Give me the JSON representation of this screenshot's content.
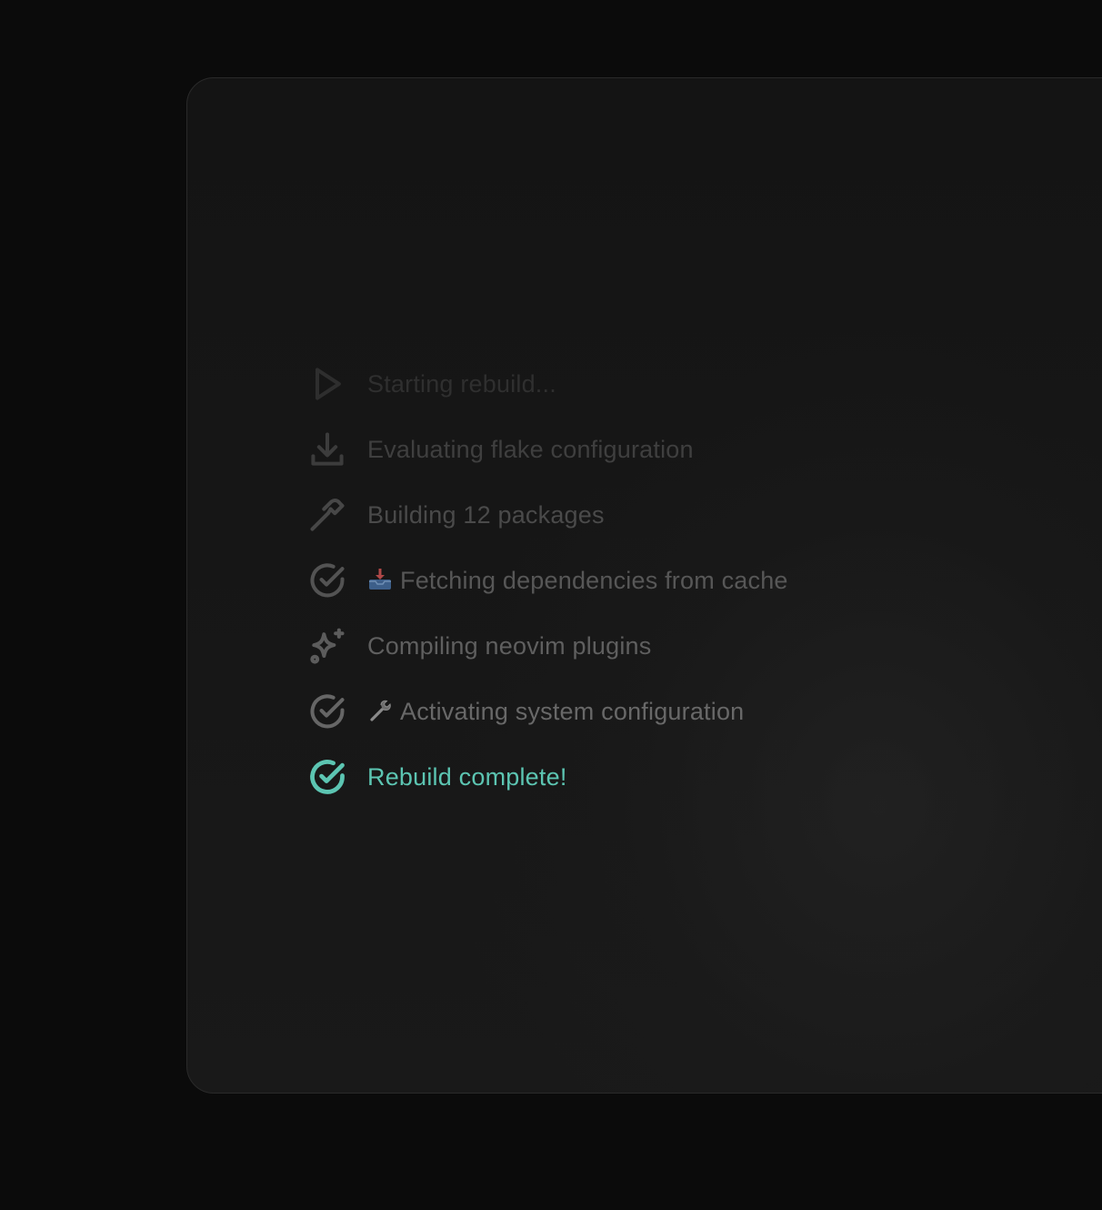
{
  "steps": [
    {
      "icon": "play-icon",
      "emoji": "",
      "label": "Starting rebuild...",
      "state": "faint"
    },
    {
      "icon": "download-icon",
      "emoji": "",
      "label": "Evaluating flake configuration",
      "state": "dim"
    },
    {
      "icon": "hammer-icon",
      "emoji": "",
      "label": "Building 12 packages",
      "state": "mid"
    },
    {
      "icon": "check-circle-icon",
      "emoji": "inbox-tray-emoji",
      "label": "Fetching dependencies from cache",
      "state": "mid2"
    },
    {
      "icon": "sparkles-icon",
      "emoji": "",
      "label": "Compiling neovim plugins",
      "state": "mid3"
    },
    {
      "icon": "check-circle-icon",
      "emoji": "wrench-emoji",
      "label": "Activating system configuration",
      "state": "mid4"
    },
    {
      "icon": "check-circle-icon",
      "emoji": "",
      "label": "Rebuild complete!",
      "state": "done"
    }
  ],
  "colors": {
    "background": "#0b0b0b",
    "card": "#161616",
    "success": "#5cc5b2"
  }
}
